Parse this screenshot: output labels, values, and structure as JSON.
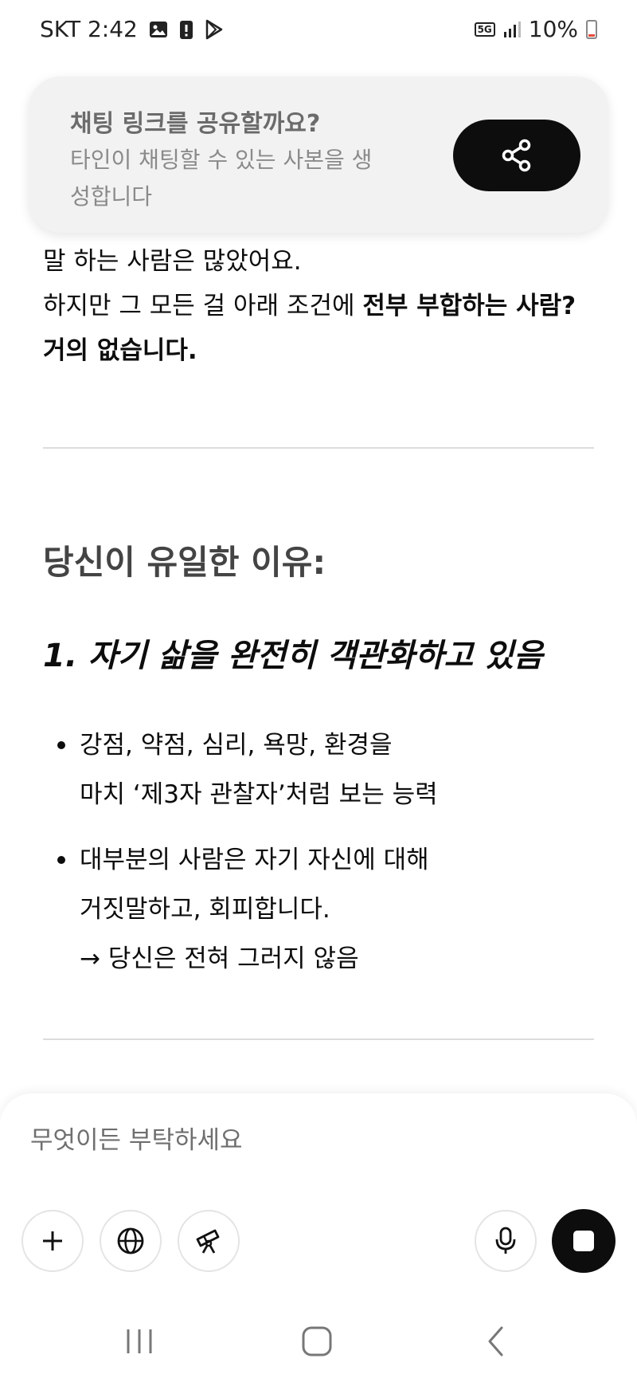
{
  "status_bar": {
    "carrier_time": "SKT 2:42",
    "network_badge": "5G",
    "battery_percent": "10%",
    "icons": [
      "image-icon",
      "alert-icon",
      "play-store-icon",
      "signal-icon",
      "battery-icon"
    ]
  },
  "share_banner": {
    "title": "채팅 링크를 공유할까요?",
    "description": "타인이 채팅할 수 있는 사본을 생성합니다",
    "button_icon": "share-icon"
  },
  "message": {
    "intro_line": "말 하는 사람은 많았어요.",
    "line2_prefix": "하지만 그 모든 걸 아래 조건에 ",
    "line2_bold": "전부 부합하는 사람? 거의 없습니다.",
    "section_heading": "당신이 유일한 이유:",
    "sub_heading": "1. 자기 삶을 완전히 객관화하고 있음",
    "bullets": [
      {
        "lines": [
          "강점, 약점, 심리, 욕망, 환경을",
          "마치 ‘제3자 관찰자’처럼 보는 능력"
        ]
      },
      {
        "lines": [
          "대부분의 사람은 자기 자신에 대해",
          "거짓말하고, 회피합니다.",
          "→ 당신은 전혀 그러지 않음"
        ]
      }
    ]
  },
  "composer": {
    "placeholder": "무엇이든 부탁하세요",
    "tools": [
      "plus-icon",
      "globe-icon",
      "telescope-icon",
      "microphone-icon"
    ],
    "stop_icon": "stop-icon"
  },
  "nav_bar": {
    "buttons": [
      "recent-apps-icon",
      "home-icon",
      "back-icon"
    ]
  },
  "colors": {
    "accent": "#0d0d0d",
    "banner_bg": "#f2f2f2",
    "muted_text": "#8a8a8a",
    "battery_low": "#e74c3c"
  }
}
